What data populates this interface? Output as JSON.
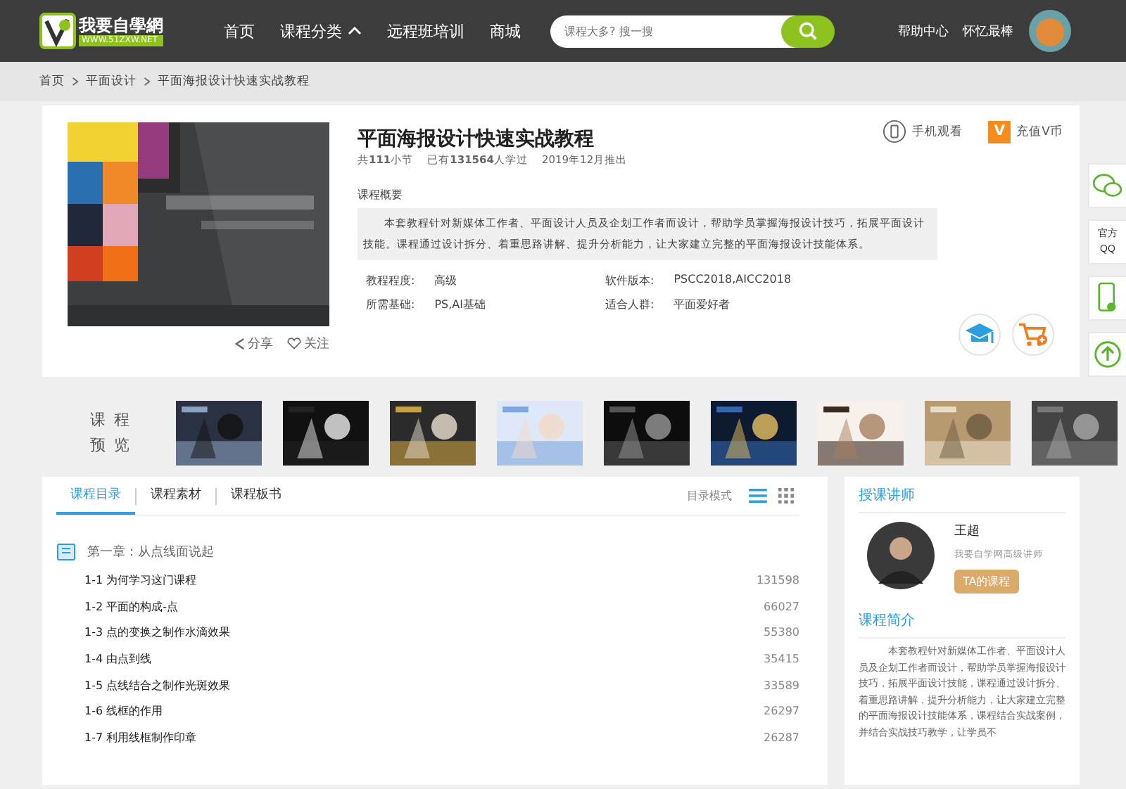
{
  "header": {
    "logo": {
      "title": "我要自學網",
      "url": "WWW.51ZXW.NET"
    },
    "nav": [
      {
        "label": "首页",
        "kind": "link"
      },
      {
        "label": "课程分类",
        "kind": "dropdown"
      },
      {
        "label": "远程班培训",
        "kind": "link"
      },
      {
        "label": "商城",
        "kind": "link"
      }
    ],
    "search": {
      "placeholder": "课程大多? 搜一搜"
    },
    "links": [
      "帮助中心",
      "怀忆最棒"
    ]
  },
  "breadcrumb": [
    "首页",
    "平面设计",
    "平面海报设计快速实战教程"
  ],
  "course": {
    "title": "平面海报设计快速实战教程",
    "stats": [
      "共**111**小节",
      "已有**131564**人学过",
      "2019年12月推出"
    ],
    "actions": [
      {
        "kind": "share",
        "label": "分享"
      },
      {
        "kind": "follow",
        "label": "关注"
      }
    ],
    "top_links": [
      {
        "kind": "phone",
        "label": "手机观看"
      },
      {
        "kind": "vcoin",
        "badge": "V",
        "label": "充值V币"
      }
    ],
    "summary_label": "课程概要",
    "summary": "本套教程针对新媒体工作者、平面设计人员及企划工作者而设计，帮助学员掌握海报设计技巧，拓展平面设计技能。课程通过设计拆分、着重思路讲解、提升分析能力，让大家建立完整的平面海报设计技能体系。",
    "details": [
      {
        "label": "教程程度:",
        "value": "高级"
      },
      {
        "label": "软件版本:",
        "value": "PSCC2018,AICC2018"
      },
      {
        "label": "所需基础:",
        "value": "PS,AI基础"
      },
      {
        "label": "适合人群:",
        "value": "平面爱好者"
      }
    ],
    "round_buttons": [
      {
        "kind": "study"
      },
      {
        "kind": "cart"
      }
    ]
  },
  "side_tools": [
    {
      "kind": "wechat"
    },
    {
      "kind": "qq",
      "lines": [
        "官方",
        "QQ"
      ]
    },
    {
      "kind": "phone"
    },
    {
      "kind": "top"
    }
  ],
  "preview": {
    "label": "课程预览"
  },
  "catalog": {
    "tabs": [
      {
        "label": "课程目录",
        "selected": true
      },
      {
        "label": "课程素材",
        "selected": false
      },
      {
        "label": "课程板书",
        "selected": false
      }
    ],
    "mode_label": "目录模式",
    "views": [
      {
        "kind": "list",
        "selected": true
      },
      {
        "kind": "grid",
        "selected": false
      }
    ],
    "chapter": "第一章：从点线面说起",
    "lessons": [
      {
        "title": "1-1 为何学习这门课程",
        "count": "131598"
      },
      {
        "title": "1-2 平面的构成-点",
        "count": "66027"
      },
      {
        "title": "1-3 点的变换之制作水滴效果",
        "count": "55380"
      },
      {
        "title": "1-4 由点到线",
        "count": "35415"
      },
      {
        "title": "1-5 点线结合之制作光斑效果",
        "count": "33589"
      },
      {
        "title": "1-6 线框的作用",
        "count": "26297"
      },
      {
        "title": "1-7 利用线框制作印章",
        "count": "26287"
      }
    ]
  },
  "teacher": {
    "heading": "授课讲师",
    "name": "王超",
    "role": "我要自学网高级讲师",
    "button": "TA的课程"
  },
  "intro": {
    "heading": "课程简介",
    "text": "本套教程针对新媒体工作者、平面设计人员及企划工作者而设计，帮助学员掌握海报设计技巧，拓展平面设计技能，课程通过设计拆分、着重思路讲解，提升分析能力，让大家建立完整的平面海报设计技能体系，课程结合实战案例，并结合实战技巧教学，让学员不"
  }
}
